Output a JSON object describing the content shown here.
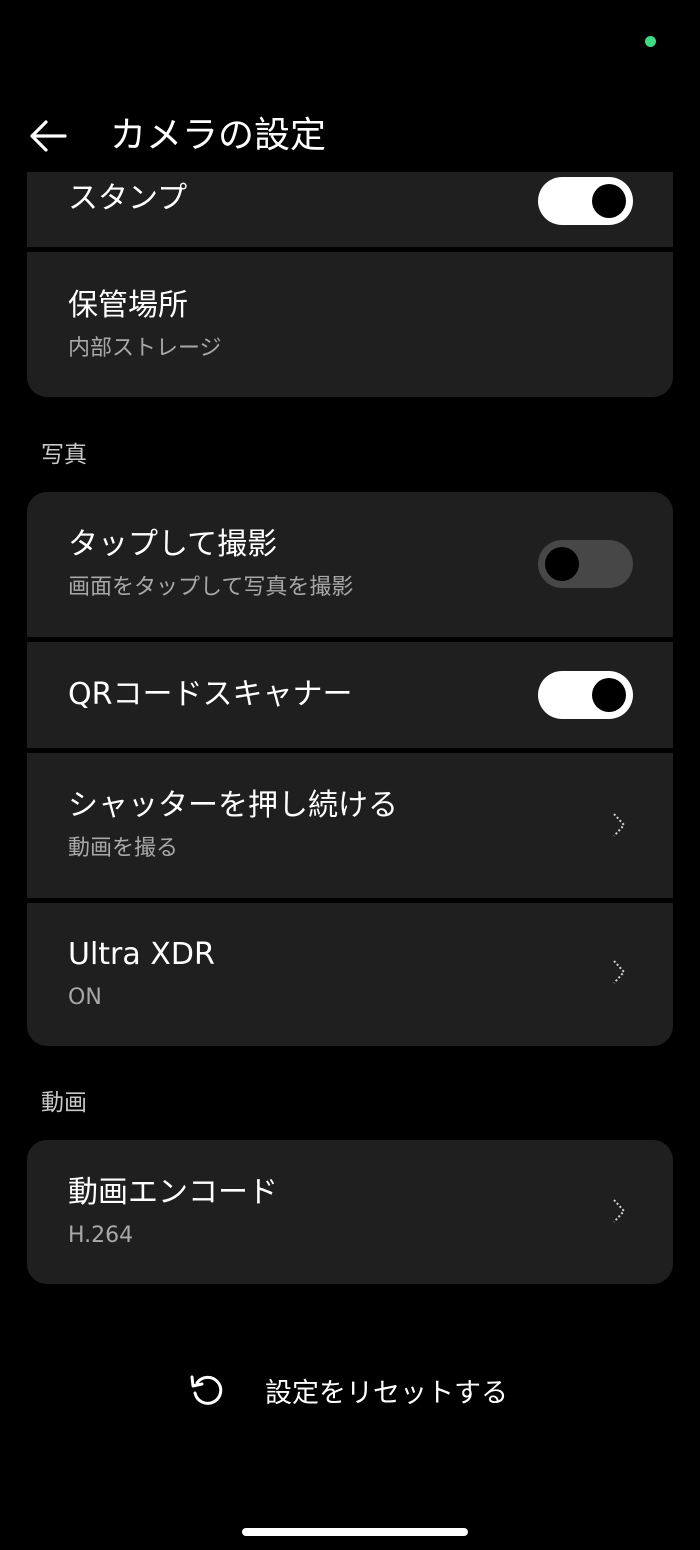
{
  "header": {
    "title": "カメラの設定",
    "back_icon": "arrow-left-icon"
  },
  "general": {
    "stamp": {
      "title": "スタンプ",
      "toggle_on": true
    },
    "storage": {
      "title": "保管場所",
      "value": "内部ストレージ"
    }
  },
  "photo": {
    "section_label": "写真",
    "tap_to_shoot": {
      "title": "タップして撮影",
      "subtitle": "画面をタップして写真を撮影",
      "toggle_on": false
    },
    "qr_scanner": {
      "title": "QRコードスキャナー",
      "toggle_on": true
    },
    "hold_shutter": {
      "title": "シャッターを押し続ける",
      "value": "動画を撮る"
    },
    "ultra_xdr": {
      "title": "Ultra XDR",
      "value": "ON"
    }
  },
  "video": {
    "section_label": "動画",
    "encode": {
      "title": "動画エンコード",
      "value": "H.264"
    }
  },
  "reset": {
    "label": "設定をリセットする",
    "icon": "reset-icon"
  },
  "colors": {
    "background": "#000000",
    "card": "#1f1f1f",
    "toggle_on_track": "#ffffff",
    "toggle_off_track": "#474747",
    "status_dot": "#3ddc84"
  }
}
